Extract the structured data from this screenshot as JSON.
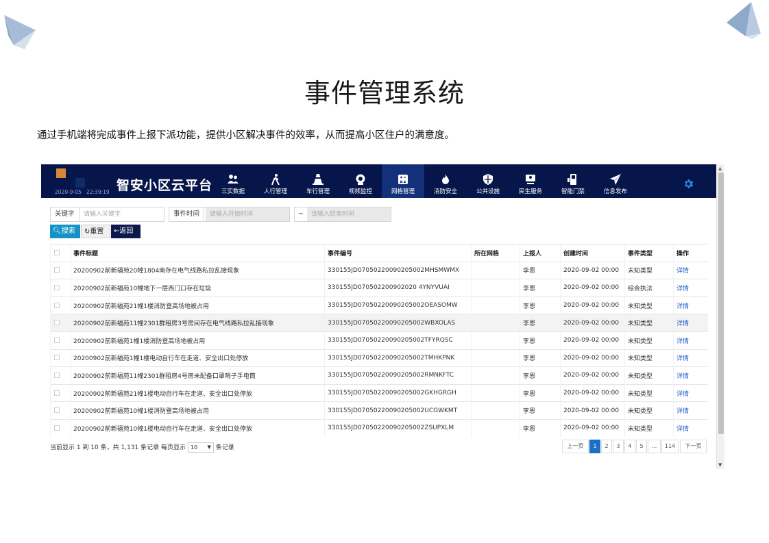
{
  "page": {
    "title": "事件管理系统",
    "description": "通过手机端将完成事件上报下派功能，提供小区解决事件的效率，从而提高小区住户的满意度。"
  },
  "app": {
    "date": "2020-9-05",
    "time": "22:39:19",
    "brand": "智安小区云平台",
    "nav": [
      {
        "label": "三实数据",
        "icon": "people-icon"
      },
      {
        "label": "人行管理",
        "icon": "walking-person-icon"
      },
      {
        "label": "车行管理",
        "icon": "traffic-cone-icon"
      },
      {
        "label": "视频监控",
        "icon": "camera-icon"
      },
      {
        "label": "网格管理",
        "icon": "grid-calculator-icon"
      },
      {
        "label": "消防安全",
        "icon": "fire-icon"
      },
      {
        "label": "公共设施",
        "icon": "shield-icon"
      },
      {
        "label": "民生服务",
        "icon": "monitor-icon"
      },
      {
        "label": "智能门禁",
        "icon": "door-phone-icon"
      },
      {
        "label": "信息发布",
        "icon": "paper-plane-icon"
      }
    ],
    "active_nav": "网格管理",
    "settings_icon": "gear-icon",
    "colors": {
      "nav_bg": "#06154a",
      "accent": "#1593c7",
      "link": "#1f5fc8"
    }
  },
  "filters": {
    "keyword_label": "关键字",
    "keyword_placeholder": "请输入关键字",
    "time_label": "事件时间",
    "start_placeholder": "请输入开始时间",
    "separator": "~",
    "end_placeholder": "请输入结束时间"
  },
  "buttons": {
    "search": "搜索",
    "reset": "重置",
    "back": "返回"
  },
  "table": {
    "columns": [
      "事件标题",
      "事件编号",
      "所在网格",
      "上报人",
      "创建时间",
      "事件类型",
      "操作"
    ],
    "rows": [
      {
        "title": "20200902前新福苑20幢1804南存在电气线路私拉乱接现象",
        "code": "330155JD07050220090205002MHSMWMX",
        "grid": "",
        "reporter": "李恩",
        "time": "2020-09-02 00:00",
        "type": "未知类型",
        "action": "详情"
      },
      {
        "title": "20200902前新福苑10幢地下一层西门口存在垃圾",
        "code": "330155JD070502200902020 4YNYVUAI",
        "grid": "",
        "reporter": "李恩",
        "time": "2020-09-02 00:00",
        "type": "综合执法",
        "action": "详情"
      },
      {
        "title": "20200902前新福苑21幢1楼消防登高场地被占用",
        "code": "330155JD07050220090205002OEASOMW",
        "grid": "",
        "reporter": "李恩",
        "time": "2020-09-02 00:00",
        "type": "未知类型",
        "action": "详情"
      },
      {
        "title": "20200902前新福苑11幢2301群租房3号房间存在电气线路私拉乱接现象",
        "code": "330155JD07050220090205002WBXOLAS",
        "grid": "",
        "reporter": "李恩",
        "time": "2020-09-02 00:00",
        "type": "未知类型",
        "action": "详情"
      },
      {
        "title": "20200902前新福苑1幢1楼消防登高场地被占用",
        "code": "330155JD07050220090205002TFYRQSC",
        "grid": "",
        "reporter": "李恩",
        "time": "2020-09-02 00:00",
        "type": "未知类型",
        "action": "详情"
      },
      {
        "title": "20200902前新福苑1幢1楼电动自行车在走道、安全出口处停放",
        "code": "330155JD07050220090205002TMHKPNK",
        "grid": "",
        "reporter": "李恩",
        "time": "2020-09-02 00:00",
        "type": "未知类型",
        "action": "详情"
      },
      {
        "title": "20200902前新福苑11幢2301群租房4号房未配备口罩哨子手电筒",
        "code": "330155JD07050220090205002RMNKFTC",
        "grid": "",
        "reporter": "李恩",
        "time": "2020-09-02 00:00",
        "type": "未知类型",
        "action": "详情"
      },
      {
        "title": "20200902前新福苑21幢1楼电动自行车在走道、安全出口处停放",
        "code": "330155JD07050220090205002GKHGRGH",
        "grid": "",
        "reporter": "李恩",
        "time": "2020-09-02 00:00",
        "type": "未知类型",
        "action": "详情"
      },
      {
        "title": "20200902前新福苑10幢1楼消防登高场地被占用",
        "code": "330155JD07050220090205002UCGWKMT",
        "grid": "",
        "reporter": "李恩",
        "time": "2020-09-02 00:00",
        "type": "未知类型",
        "action": "详情"
      },
      {
        "title": "20200902前新福苑10幢1楼电动自行车在走道、安全出口处停放",
        "code": "330155JD07050220090205002ZSUPXLM",
        "grid": "",
        "reporter": "李恩",
        "time": "2020-09-02 00:00",
        "type": "未知类型",
        "action": "详情"
      }
    ],
    "highlighted_row": 3
  },
  "footer": {
    "summary": "当前显示 1 到 10 条，共 1,131 条记录 每页显示",
    "page_size": "10",
    "page_size_suffix": "条记录"
  },
  "pagination": {
    "prev": "上一页",
    "pages": [
      "1",
      "2",
      "3",
      "4",
      "5",
      "...",
      "114"
    ],
    "current": "1",
    "next": "下一页"
  }
}
